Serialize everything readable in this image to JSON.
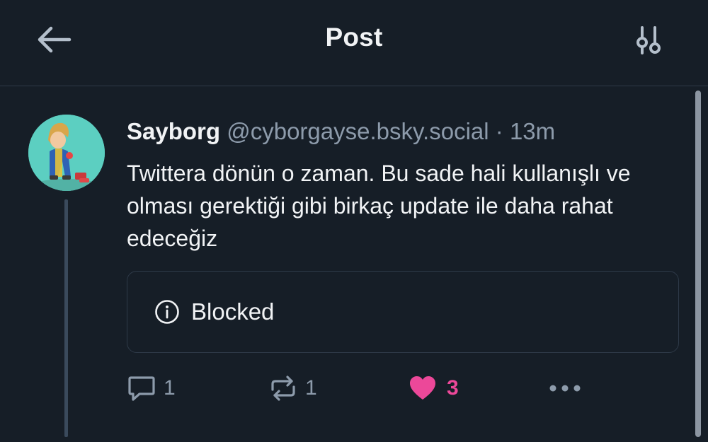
{
  "header": {
    "title": "Post",
    "back_icon": "arrow-left-icon",
    "settings_icon": "sliders-icon"
  },
  "post": {
    "author_name": "Sayborg",
    "author_handle": "@cyborgayse.bsky.social",
    "separator": "·",
    "timestamp": "13m",
    "text": "Twittera dönün o zaman. Bu sade hali kullanışlı ve olması gerektiği gibi birkaç update ile daha rahat edeceğiz",
    "embed": {
      "icon": "info-icon",
      "label": "Blocked"
    },
    "actions": {
      "reply_count": "1",
      "repost_count": "1",
      "like_count": "3",
      "liked": true
    }
  },
  "colors": {
    "background": "#161e27",
    "text_primary": "#f1f3f5",
    "text_secondary": "#8d9bab",
    "like_accent": "#ec4899",
    "border": "#2e3a48"
  }
}
